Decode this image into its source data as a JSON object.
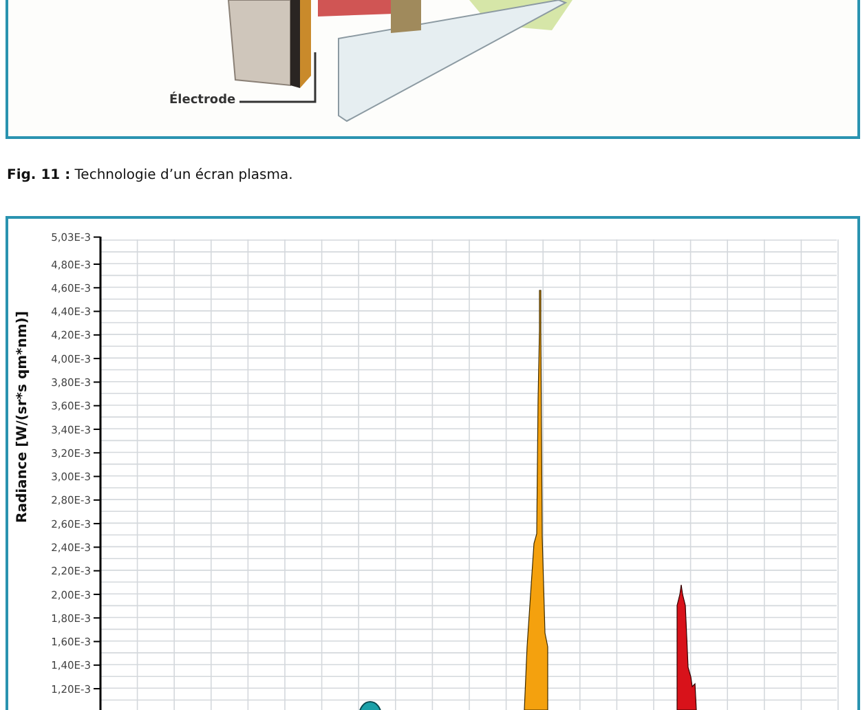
{
  "figure_top": {
    "callout": "Électrode"
  },
  "caption": "**Fig. 11 :** Technologie d’un écran plasma.",
  "spectrum_chart": {
    "y_axis_title": "Radiance [W/(sr*s qm*nm)]",
    "y_ticks": [
      "5,03E-3",
      "4,80E-3",
      "4,60E-3",
      "4,40E-3",
      "4,20E-3",
      "4,00E-3",
      "3,80E-3",
      "3,60E-3",
      "3,40E-3",
      "3,20E-3",
      "3,00E-3",
      "2,80E-3",
      "2,60E-3",
      "2,40E-3",
      "2,20E-3",
      "2,00E-3",
      "1,80E-3",
      "1,60E-3",
      "1,40E-3",
      "1,20E-3"
    ]
  }
}
